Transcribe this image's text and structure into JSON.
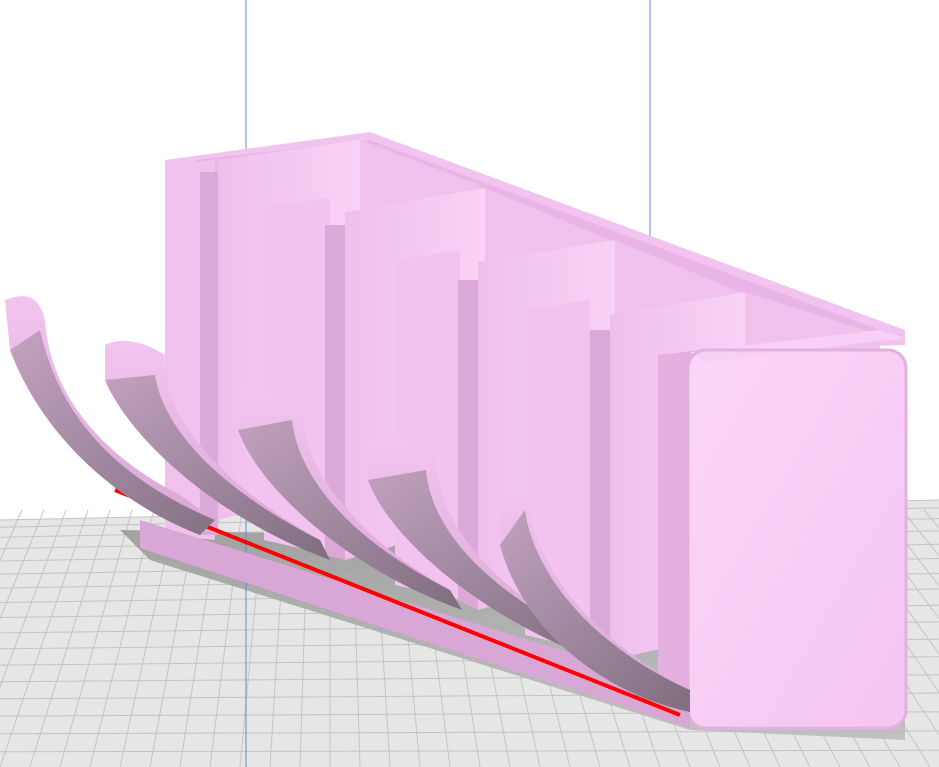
{
  "viewport": {
    "view": "3d-perspective",
    "background_color": "#ffffff",
    "build_plate": {
      "grid": true,
      "plate_color": "#e6e6e6",
      "grid_line_color": "#c4c4c4",
      "major_grid_line_color": "#b3b3b3"
    },
    "guide_lines": {
      "count": 2,
      "color": "#5b8fd6"
    },
    "model": {
      "color": "#f6c8f3",
      "shade_color": "#d8a7d5",
      "dark_shade_color": "#8f7f8f",
      "compartments": 4,
      "curved_fins": 5,
      "overhang_highlight_color": "#ff0000"
    }
  }
}
